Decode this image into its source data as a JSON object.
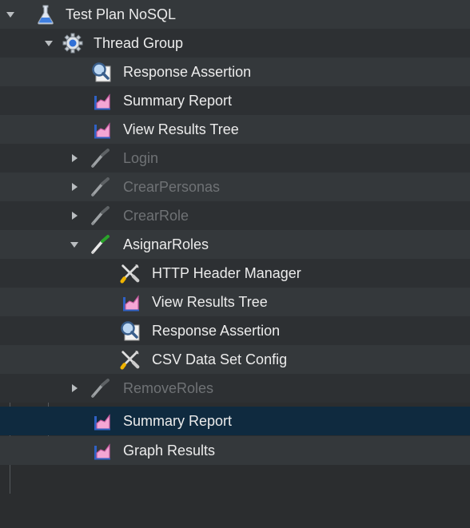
{
  "tree": {
    "nodes": [
      {
        "label": "Test Plan NoSQL",
        "icon": "flask-icon",
        "toggle": "expanded",
        "disabled": false
      },
      {
        "label": "Thread Group",
        "icon": "gear-icon",
        "toggle": "expanded",
        "disabled": false
      },
      {
        "label": "Response Assertion",
        "icon": "magnifier-icon",
        "toggle": "none",
        "disabled": false
      },
      {
        "label": "Summary Report",
        "icon": "report-chart-icon",
        "toggle": "none",
        "disabled": false
      },
      {
        "label": "View Results Tree",
        "icon": "report-chart-icon",
        "toggle": "none",
        "disabled": false
      },
      {
        "label": "Login",
        "icon": "pipette-icon",
        "toggle": "collapsed",
        "disabled": true
      },
      {
        "label": "CrearPersonas",
        "icon": "pipette-icon",
        "toggle": "collapsed",
        "disabled": true
      },
      {
        "label": "CrearRole",
        "icon": "pipette-icon",
        "toggle": "collapsed",
        "disabled": true
      },
      {
        "label": "AsignarRoles",
        "icon": "pipette-icon",
        "toggle": "expanded",
        "disabled": false
      },
      {
        "label": "HTTP Header Manager",
        "icon": "tools-icon",
        "toggle": "none",
        "disabled": false
      },
      {
        "label": "View Results Tree",
        "icon": "report-chart-icon",
        "toggle": "none",
        "disabled": false
      },
      {
        "label": "Response Assertion",
        "icon": "magnifier-icon",
        "toggle": "none",
        "disabled": false
      },
      {
        "label": "CSV Data Set Config",
        "icon": "tools-icon",
        "toggle": "none",
        "disabled": false
      },
      {
        "label": "RemoveRoles",
        "icon": "pipette-icon",
        "toggle": "collapsed",
        "disabled": true
      },
      {
        "label": "Summary Report",
        "icon": "report-chart-icon",
        "toggle": "none",
        "disabled": false,
        "selected": true
      },
      {
        "label": "Graph Results",
        "icon": "report-chart-icon",
        "toggle": "none",
        "disabled": false
      }
    ]
  }
}
